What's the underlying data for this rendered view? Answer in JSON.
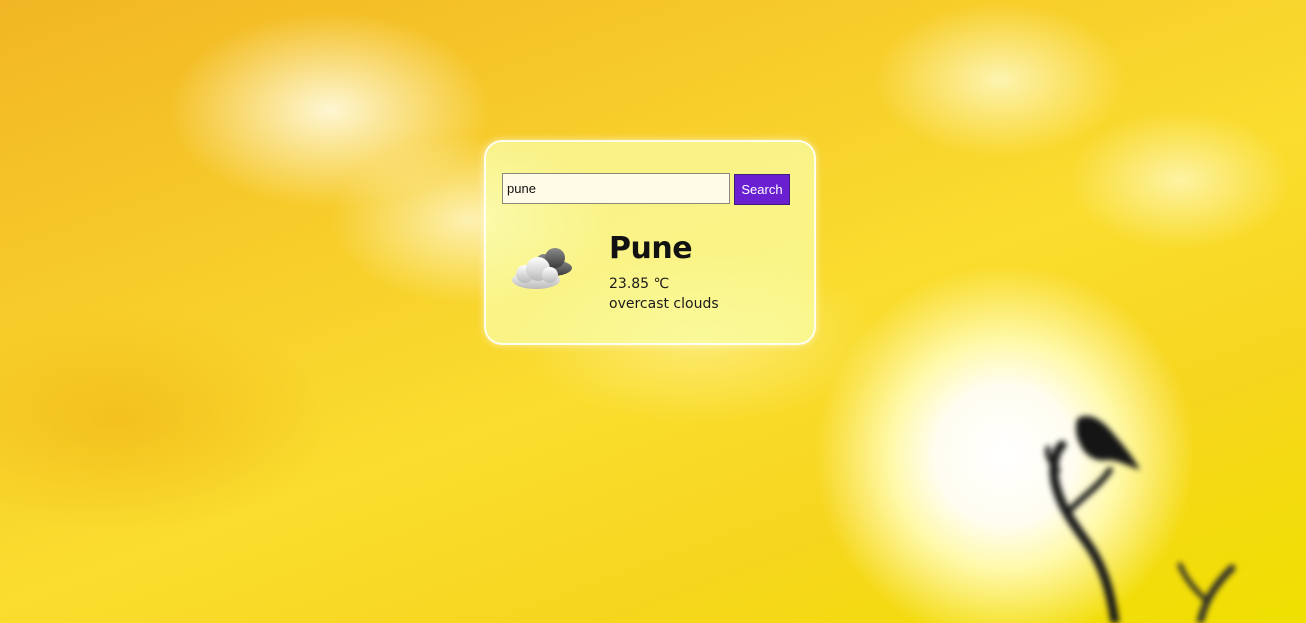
{
  "search": {
    "value": "pune",
    "button_label": "Search"
  },
  "weather": {
    "icon": "cloud-icon",
    "city": "Pune",
    "temperature": "23.85 ℃",
    "description": "overcast clouds"
  },
  "colors": {
    "button_bg": "#6a1fd1",
    "card_bg": "#faffaa",
    "background": "#f7d02a"
  }
}
